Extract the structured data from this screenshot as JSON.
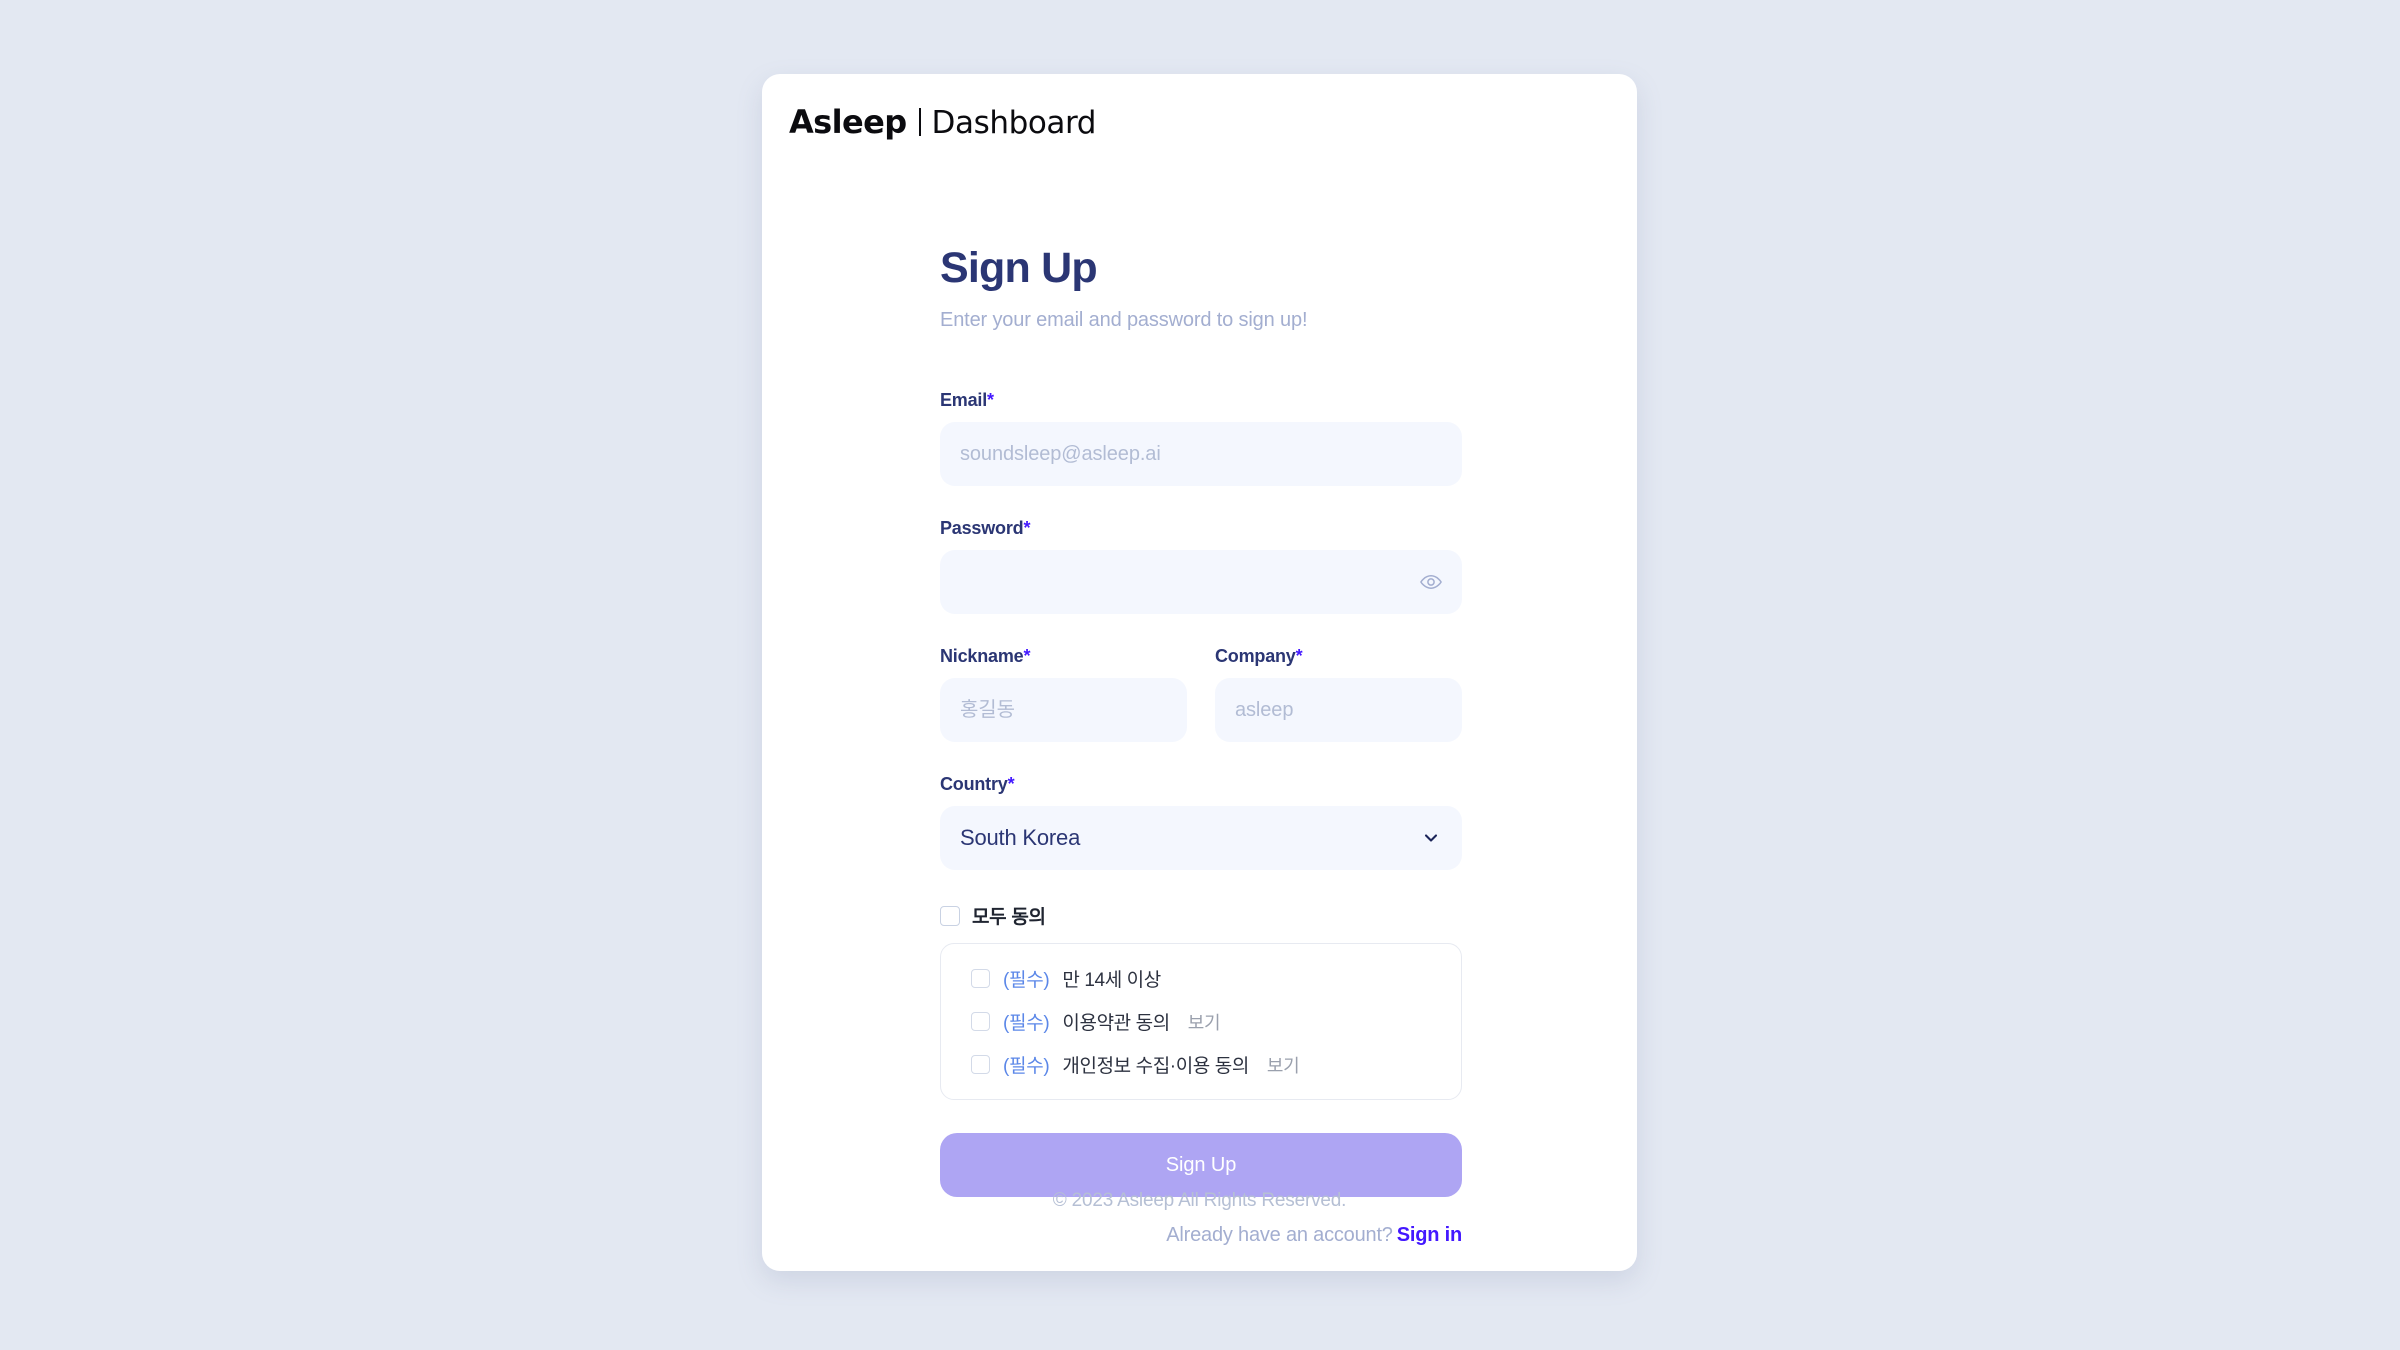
{
  "brand": {
    "mark": "Asleep",
    "word": "Dashboard"
  },
  "heading": {
    "title": "Sign Up",
    "subtitle": "Enter your email and password to sign up!"
  },
  "fields": {
    "email": {
      "label": "Email",
      "required_mark": "*",
      "placeholder": "soundsleep@asleep.ai",
      "value": ""
    },
    "password": {
      "label": "Password",
      "required_mark": "*",
      "placeholder": "",
      "value": "",
      "toggle_icon": "eye-icon"
    },
    "nickname": {
      "label": "Nickname",
      "required_mark": "*",
      "placeholder": "홍길동",
      "value": ""
    },
    "company": {
      "label": "Company",
      "required_mark": "*",
      "placeholder": "asleep",
      "value": ""
    },
    "country": {
      "label": "Country",
      "required_mark": "*",
      "selected": "South Korea",
      "chevron_icon": "chevron-down-icon"
    }
  },
  "consent": {
    "agree_all_label": "모두 동의",
    "agree_all_checked": false,
    "items": [
      {
        "tag": "(필수)",
        "text": "만 14세 이상",
        "view_label": "",
        "checked": false
      },
      {
        "tag": "(필수)",
        "text": "이용약관 동의",
        "view_label": "보기",
        "checked": false
      },
      {
        "tag": "(필수)",
        "text": "개인정보 수집·이용 동의",
        "view_label": "보기",
        "checked": false
      }
    ]
  },
  "actions": {
    "submit_label": "Sign Up",
    "have_account_text": "Already have an account?",
    "signin_label": "Sign in"
  },
  "footer": {
    "copyright": "© 2023 Asleep All Rights Reserved."
  },
  "colors": {
    "page_background": "#E3E8F2",
    "card_background": "#FFFFFF",
    "title": "#2B3674",
    "muted": "#A3AED0",
    "input_background": "#F4F7FE",
    "accent": "#4318FF",
    "submit_button": "#AEA5F3",
    "required_tag": "#5B87E8"
  }
}
